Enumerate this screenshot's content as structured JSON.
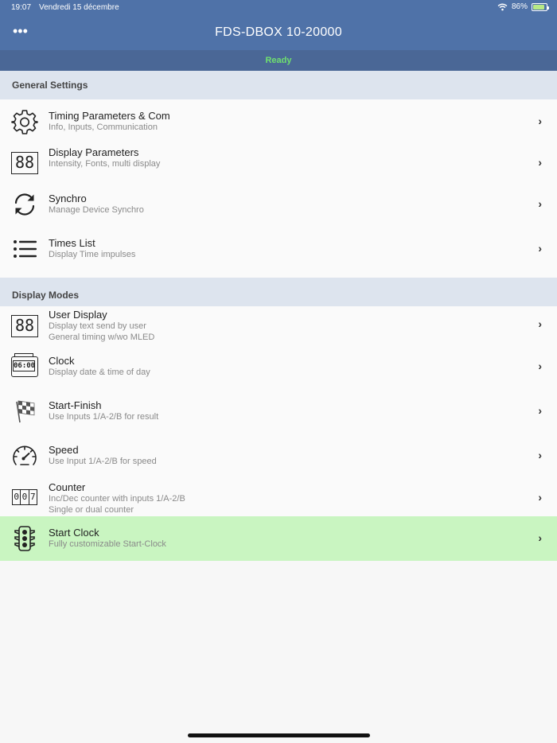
{
  "status": {
    "time": "19:07",
    "date": "Vendredi 15 décembre",
    "battery": "86%",
    "battery_level": 0.86
  },
  "header": {
    "more": "•••",
    "title": "FDS-DBOX 10-20000",
    "state": "Ready"
  },
  "sections": [
    {
      "title": "General Settings"
    },
    {
      "title": "Display Modes"
    }
  ],
  "items": [
    {
      "title": "Timing Parameters & Com",
      "sub1": "Info, Inputs, Communication",
      "sub2": "",
      "icon": "gear-icon"
    },
    {
      "title": "Display Parameters",
      "sub1": "Intensity, Fonts, multi display",
      "sub2": "",
      "icon": "display-88-icon",
      "icon_text": "88"
    },
    {
      "title": "Synchro",
      "sub1": "Manage Device Synchro",
      "sub2": "",
      "icon": "sync-icon"
    },
    {
      "title": "Times List",
      "sub1": "Display Time impulses",
      "sub2": "",
      "icon": "list-icon"
    },
    {
      "title": "User Display",
      "sub1": "Display text send by user",
      "sub2": "General timing w/wo MLED",
      "icon": "display-88-icon",
      "icon_text": "88"
    },
    {
      "title": "Clock",
      "sub1": "Display date & time of day",
      "sub2": "",
      "icon": "clock-display-icon",
      "icon_text": "06:00"
    },
    {
      "title": "Start-Finish",
      "sub1": "Use Inputs 1/A-2/B for result",
      "sub2": "",
      "icon": "checkered-flag-icon"
    },
    {
      "title": "Speed",
      "sub1": "Use Input 1/A-2/B for speed",
      "sub2": "",
      "icon": "speedometer-icon"
    },
    {
      "title": "Counter",
      "sub1": "Inc/Dec counter with inputs 1/A-2/B",
      "sub2": "Single or dual counter",
      "icon": "counter-icon",
      "icon_digits": [
        "0",
        "0",
        "7"
      ]
    },
    {
      "title": "Start Clock",
      "sub1": "Fully customizable Start-Clock",
      "sub2": "",
      "icon": "traffic-light-icon",
      "selected": true
    }
  ],
  "colors": {
    "header": "#4f72a8",
    "ready": "#6fe06f",
    "selected_row": "#c9f5c1",
    "section_bg": "#dde4ee"
  }
}
